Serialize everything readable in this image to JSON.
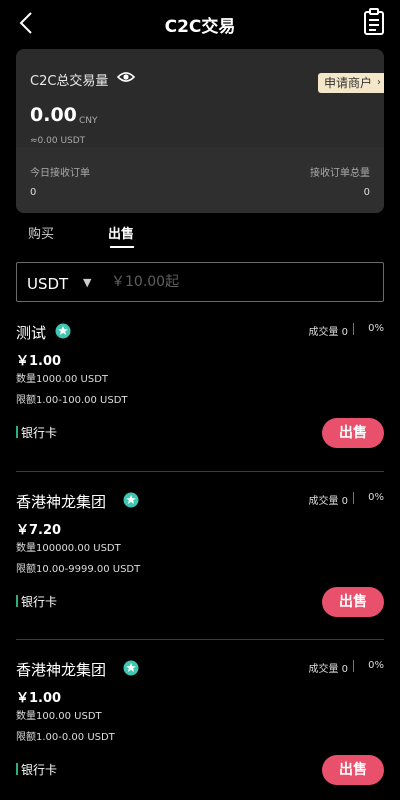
{
  "header": {
    "title": "C2C交易"
  },
  "summary": {
    "title": "C2C总交易量",
    "merchant_apply_label": "申请商户",
    "total_value": "0.00",
    "total_unit": "CNY",
    "total_usdt": "≈0.00 USDT",
    "today_orders_label": "今日接收订单",
    "today_orders_value": "0",
    "total_orders_label": "接收订单总量",
    "total_orders_value": "0"
  },
  "tabs": {
    "buy": "购买",
    "sell": "出售",
    "active": "sell"
  },
  "filter": {
    "currency": "USDT",
    "amount_placeholder": "￥10.00起"
  },
  "offers": [
    {
      "name": "测试",
      "volume": "成交量 0",
      "rate": "0%",
      "price": "￥1.00",
      "quantity": "数量1000.00 USDT",
      "limit": "限额1.00-100.00 USDT",
      "payment": "银行卡",
      "action_label": "出售"
    },
    {
      "name": "香港神龙集团",
      "volume": "成交量 0",
      "rate": "0%",
      "price": "￥7.20",
      "quantity": "数量100000.00 USDT",
      "limit": "限额10.00-9999.00 USDT",
      "payment": "银行卡",
      "action_label": "出售"
    },
    {
      "name": "香港神龙集团",
      "volume": "成交量 0",
      "rate": "0%",
      "price": "￥1.00",
      "quantity": "数量100.00 USDT",
      "limit": "限额1.00-0.00 USDT",
      "payment": "银行卡",
      "action_label": "出售"
    }
  ],
  "icons": {
    "back": "chevron-left-icon",
    "orders": "clipboard-list-icon",
    "visibility": "eye-icon",
    "verified": "verified-star-icon",
    "dropdown": "caret-down-icon"
  },
  "colors": {
    "background": "#000000",
    "card": "#2b2b2b",
    "merchant_badge": "#f3e6c9",
    "sell_button": "#e8506b",
    "payment_bar": "#2fb07a",
    "verified_badge": "#3fc7b3"
  }
}
